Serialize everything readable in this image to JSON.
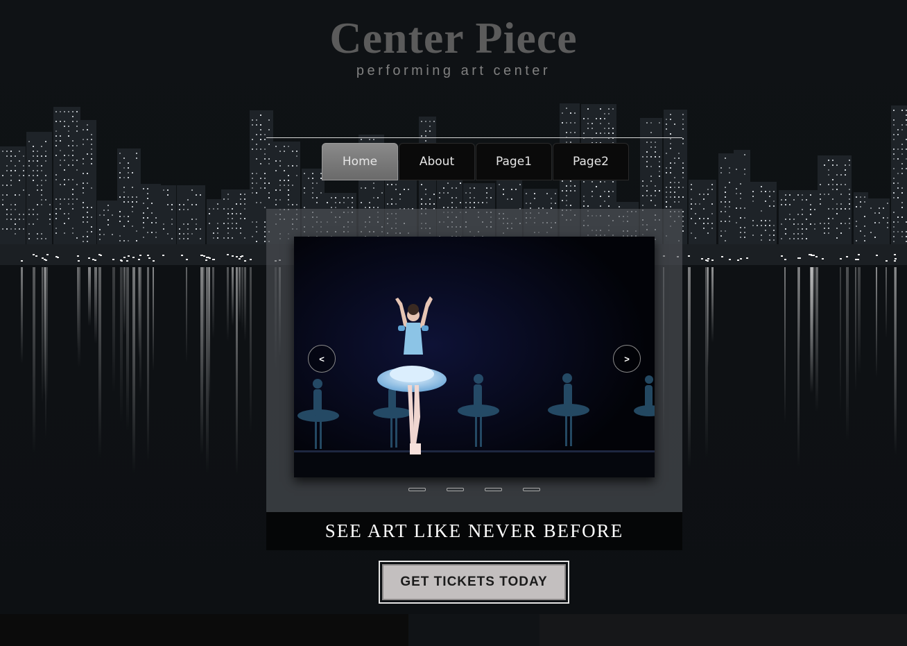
{
  "brand": {
    "title": "Center Piece",
    "subtitle": "performing art center"
  },
  "nav": {
    "tabs": [
      {
        "label": "Home",
        "active": true
      },
      {
        "label": "About",
        "active": false
      },
      {
        "label": "Page1",
        "active": false
      },
      {
        "label": "Page2",
        "active": false
      }
    ]
  },
  "slider": {
    "prev_label": "<",
    "next_label": ">",
    "slide_count": 4,
    "current_slide": 1,
    "image": "ballet-dancer-on-stage"
  },
  "tagline": "SEE ART LIKE NEVER BEFORE",
  "cta": {
    "label": "GET TICKETS TODAY"
  },
  "colors": {
    "page_background": "#0d1013",
    "brand_title": "#5b5b5b",
    "nav_active": "#7a7a7a",
    "nav_inactive": "#0a0a0a",
    "cta_background": "#c3bfbf",
    "tagline_background": "#050607"
  }
}
